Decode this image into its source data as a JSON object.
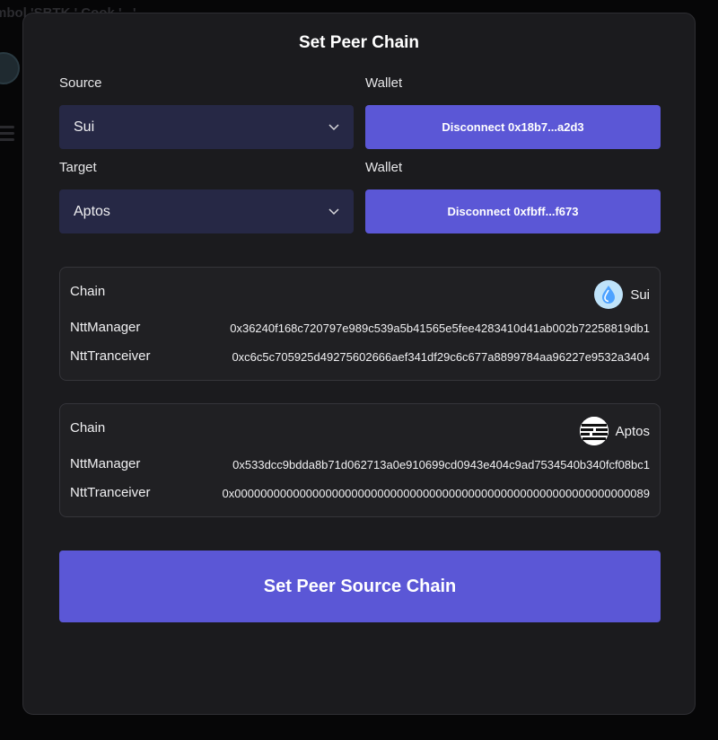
{
  "background": {
    "text": "mbol 'SBTK ' Cook  '...'.... "
  },
  "modal": {
    "title": "Set Peer Chain"
  },
  "source": {
    "label": "Source",
    "selected": "Sui",
    "wallet_label": "Wallet",
    "wallet_button": "Disconnect 0x18b7...a2d3"
  },
  "target": {
    "label": "Target",
    "selected": "Aptos",
    "wallet_label": "Wallet",
    "wallet_button": "Disconnect 0xfbff...f673"
  },
  "cards": [
    {
      "chain_label": "Chain",
      "chain_name": "Sui",
      "chain_icon": "sui-drop-icon",
      "manager_label": "NttManager",
      "manager_value": "0x36240f168c720797e989c539a5b41565e5fee4283410d41ab002b72258819db1",
      "tranceiver_label": "NttTranceiver",
      "tranceiver_value": "0xc6c5c705925d49275602666aef341df29c6c677a8899784aa96227e9532a3404"
    },
    {
      "chain_label": "Chain",
      "chain_name": "Aptos",
      "chain_icon": "aptos-lines-icon",
      "manager_label": "NttManager",
      "manager_value": "0x533dcc9bdda8b71d062713a0e910699cd0943e404c9ad7534540b340fcf08bc1",
      "tranceiver_label": "NttTranceiver",
      "tranceiver_value": "0x0000000000000000000000000000000000000000000000000000000000000089"
    }
  ],
  "action": {
    "button": "Set Peer Source Chain"
  },
  "colors": {
    "accent": "#5b57d6",
    "select_bg": "#262845",
    "modal_bg": "#1b1b1e",
    "card_bg": "#202023"
  }
}
